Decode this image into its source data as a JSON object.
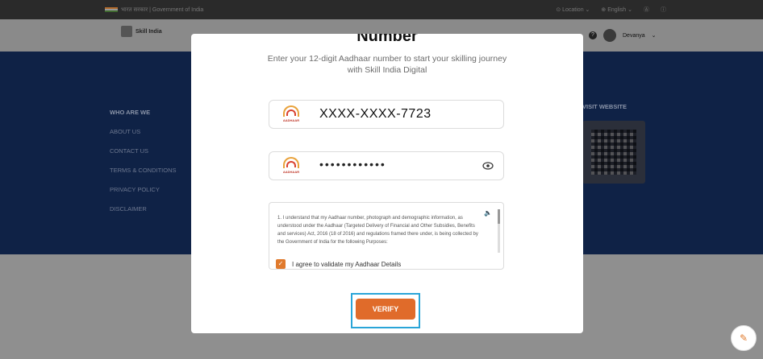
{
  "gov_bar": {
    "left_text": "भारत सरकार | Government of India",
    "location": "Location",
    "language": "English"
  },
  "header": {
    "logo_text": "Skill India",
    "user_name": "Devanya"
  },
  "footer": {
    "section_title": "WHO ARE WE",
    "links": [
      "ABOUT US",
      "CONTACT US",
      "TERMS & CONDITIONS",
      "PRIVACY POLICY",
      "DISCLAIMER"
    ],
    "visit_title": "VISIT WEBSITE"
  },
  "modal": {
    "title": "Number",
    "subtitle": "Enter your 12-digit Aadhaar number to start your skilling journey with Skill India Digital",
    "aadhaar_number": "XXXX-XXXX-7723",
    "masked_value": "••••••••••••",
    "aadhaar_logo_text": "AADHAAR",
    "consent_text": "1. I understand that my Aadhaar number, photograph and demographic information, as understood under the Aadhaar (Targeted Delivery of Financial and Other Subsidies, Benefits and services) Act, 2016 (18 of 2016) and regulations framed there under, is being collected by the Government of India for the following Purposes:",
    "agree_label": "I agree to validate my Aadhaar Details",
    "agree_checked": true,
    "verify_label": "VERIFY"
  },
  "colors": {
    "accent": "#e06b2a",
    "highlight": "#2aa5d8",
    "navy": "#0f2246"
  }
}
